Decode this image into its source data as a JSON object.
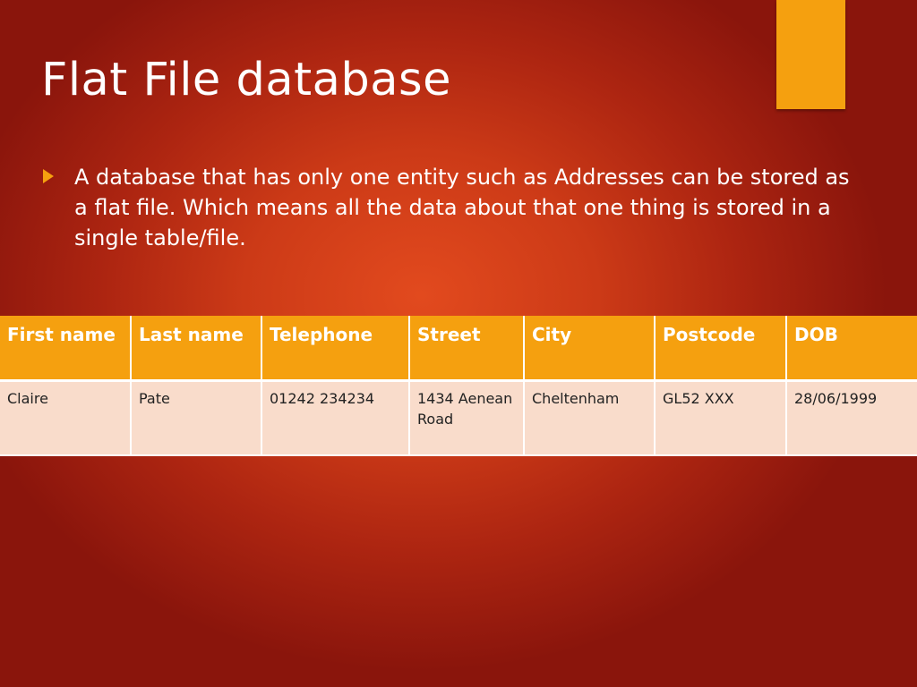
{
  "slide": {
    "title": "Flat File database",
    "bullet": "A database that has only one entity such as Addresses can be stored as a flat file.  Which means all the data about that one thing is stored in a single table/file.",
    "accent_color": "#f5a00f",
    "bullet_icon": "triangle-right-icon"
  },
  "table": {
    "headers": [
      "First name",
      "Last name",
      "Telephone",
      "Street",
      "City",
      "Postcode",
      "DOB"
    ],
    "rows": [
      [
        "Claire",
        "Pate",
        "01242 234234",
        "1434 Aenean Road",
        "Cheltenham",
        "GL52 XXX",
        "28/06/1999"
      ]
    ]
  }
}
